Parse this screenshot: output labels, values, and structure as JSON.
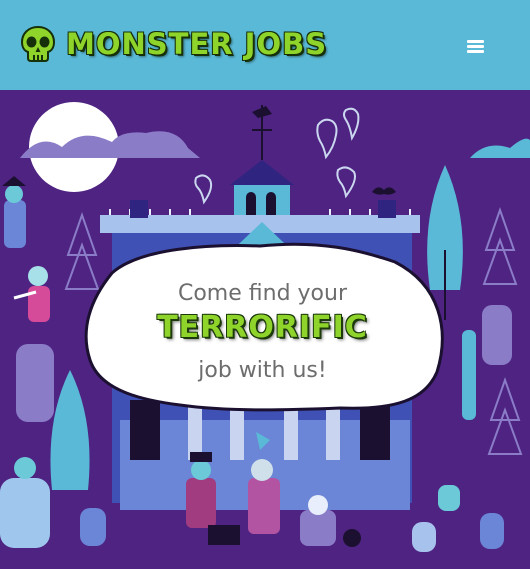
{
  "navbar": {
    "brand_text": "MONSTER JOBS",
    "logo_icon": "skull-icon",
    "menu_icon": "hamburger-menu-icon"
  },
  "hero": {
    "line1": "Come find your",
    "line2": "TERRORIFIC",
    "line3": "job with us!"
  },
  "colors": {
    "navbar": "#5ab9d6",
    "background": "#4e2382",
    "accent_green": "#8fd42a",
    "text_gray": "#6d6d6d"
  }
}
